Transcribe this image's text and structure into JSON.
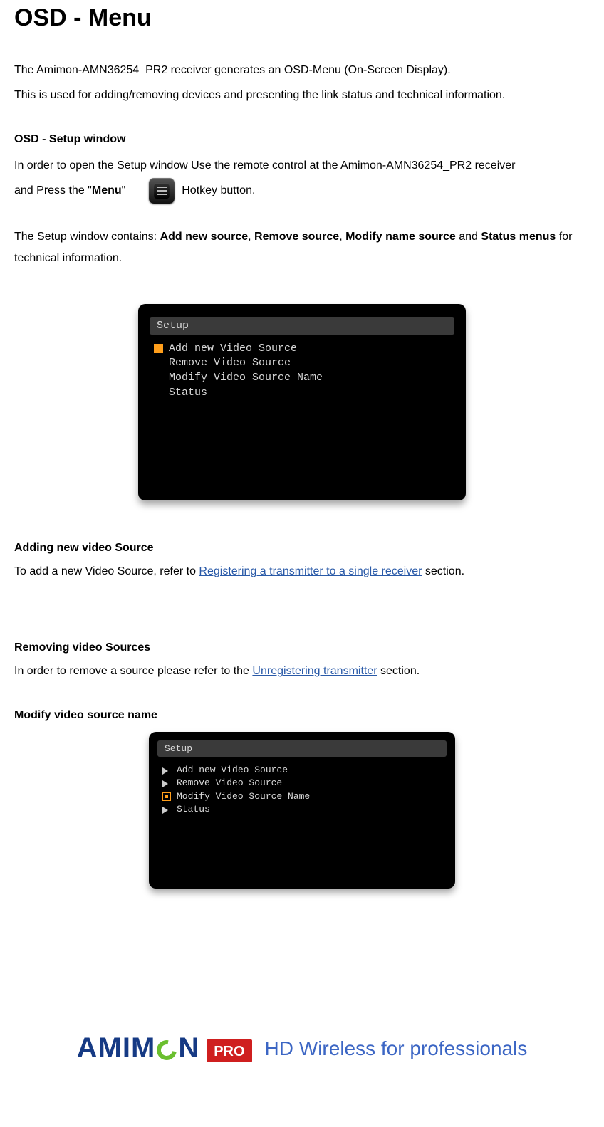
{
  "title": "OSD - Menu",
  "intro": {
    "p1": "The Amimon-AMN36254_PR2 receiver generates an OSD-Menu (On-Screen Display).",
    "p2": "This is used for adding/removing devices and presenting the link status and technical information."
  },
  "setup": {
    "heading": "OSD - Setup window",
    "line1_a": "In order to open the Setup window Use the remote control at the Amimon-AMN36254_PR2 receiver",
    "line2_a": "and Press the \"",
    "menu_word": "Menu",
    "line2_b": "\"",
    "line2_c": " Hotkey button.",
    "icon_name": "menu-hotkey-icon"
  },
  "contains": {
    "pre": "The Setup window contains: ",
    "s1": "Add new source",
    "c1": ", ",
    "s2": "Remove source",
    "c2": ", ",
    "s3": "Modify name source",
    "c3": " and ",
    "s4": "Status menus",
    "post": " for technical information."
  },
  "osd1": {
    "title": "Setup",
    "items": [
      {
        "marker": "sel",
        "label": "Add new Video Source"
      },
      {
        "marker": "none",
        "label": "Remove Video Source"
      },
      {
        "marker": "none",
        "label": "Modify Video Source Name"
      },
      {
        "marker": "none",
        "label": "Status"
      }
    ]
  },
  "add": {
    "heading": "Adding new video Source",
    "pre": "To add a new Video Source, refer to ",
    "link": "Registering a transmitter to a single receiver",
    "post": " section."
  },
  "remove": {
    "heading": "Removing video Sources",
    "pre": "In order to remove a source please refer to the ",
    "link": "Unregistering transmitter",
    "post": " section."
  },
  "modify": {
    "heading": "Modify video source name"
  },
  "osd2": {
    "title": "Setup",
    "items": [
      {
        "marker": "arrow",
        "label": "Add new Video Source"
      },
      {
        "marker": "arrow",
        "label": "Remove Video Source"
      },
      {
        "marker": "sel-out",
        "label": "Modify Video Source Name"
      },
      {
        "marker": "arrow",
        "label": "Status"
      }
    ]
  },
  "footer": {
    "brand_a": "AMIM",
    "brand_b": "N",
    "pro": "PRO",
    "tagline": "HD Wireless for professionals"
  }
}
